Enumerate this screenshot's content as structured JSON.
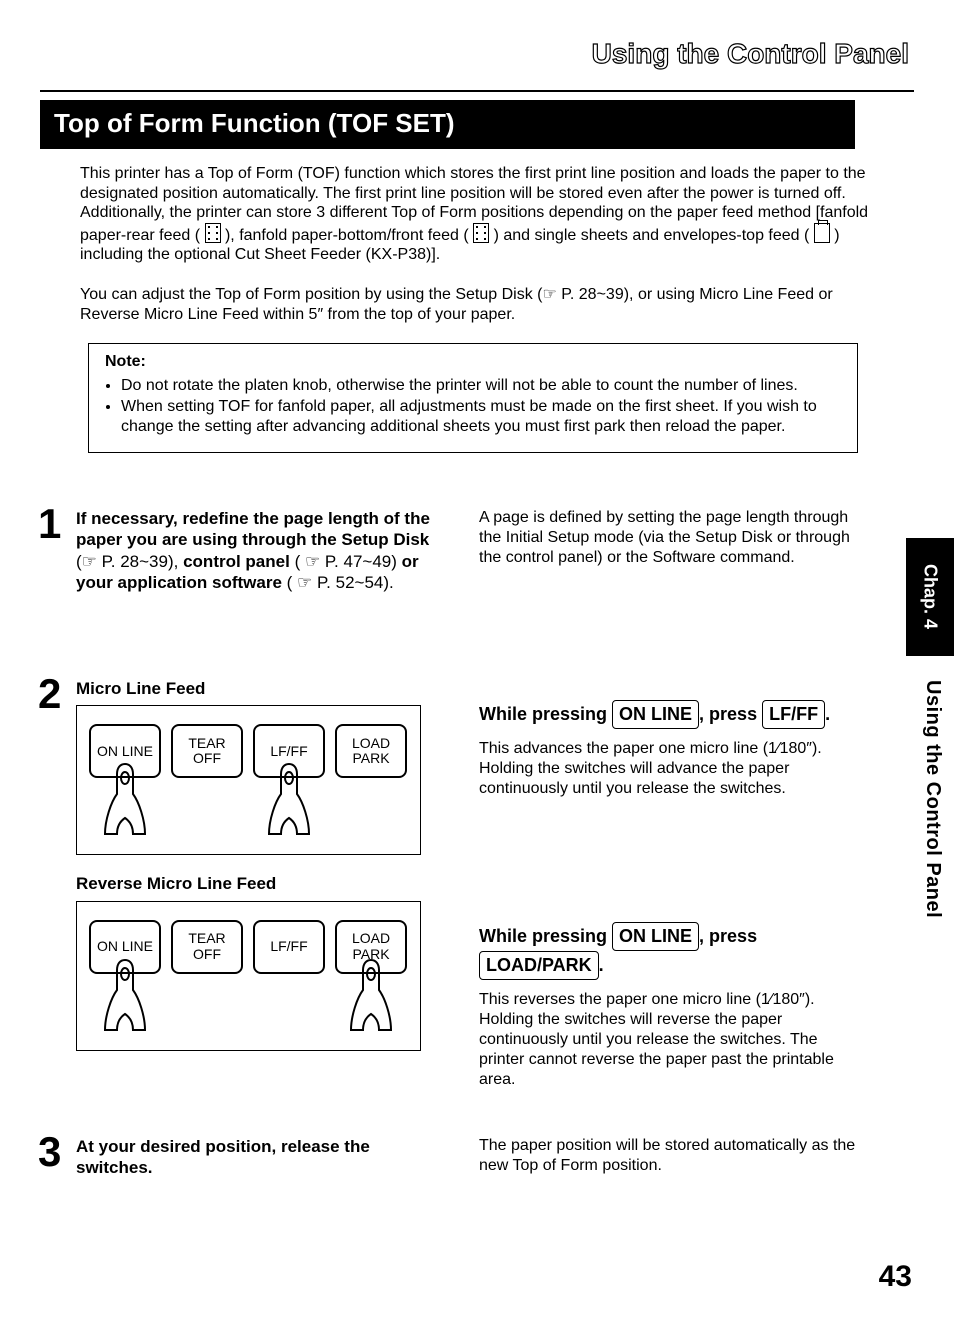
{
  "header": "Using the Control Panel",
  "title_bar": "Top of Form Function (TOF SET)",
  "intro_p1": "This printer has a Top of Form (TOF) function which stores the first print line position and loads the paper to the designated position automatically. The first print line position will be stored even after the power is turned off. Additionally, the printer can store 3 different Top of Form positions depending on the paper feed method [fanfold paper-rear feed (",
  "intro_p1_mid1": "), fanfold paper-bottom/front feed (",
  "intro_p1_mid2": ") and single sheets and envelopes-top feed (",
  "intro_p1_end": ") including the optional Cut Sheet Feeder (KX-P38)].",
  "intro_p2": "You can adjust the Top of Form position by using the Setup Disk (☞ P. 28~39), or using Micro Line Feed or Reverse Micro Line Feed within 5″ from the top of your paper.",
  "note_label": "Note:",
  "note_items": [
    "Do not rotate the platen knob, otherwise the printer will not be able to count the number of lines.",
    "When setting TOF for fanfold paper, all adjustments must be made on the first sheet. If you wish to change the setting after advancing additional sheets you must first park then reload the paper."
  ],
  "step1": {
    "num": "1",
    "left_a": "If necessary, redefine the page length of the paper you are using through the Setup Disk",
    "left_b": "(☞ P. 28~39),",
    "left_c": "control panel",
    "left_d": "( ☞ P. 47~49)",
    "left_e": "or your application software",
    "left_f": "( ☞ P. 52~54).",
    "right": "A page is defined by setting the page length through the Initial Setup mode (via the Setup Disk or through the control panel) or the Software command."
  },
  "step2": {
    "num": "2",
    "title_a": "Micro Line Feed",
    "title_b": "Reverse Micro Line Feed",
    "buttons": [
      "ON LINE",
      "TEAR OFF",
      "LF/FF",
      "LOAD PARK"
    ],
    "instr_a_pre": "While pressing ",
    "instr_a_key1": "ON LINE",
    "instr_a_mid": ", press ",
    "instr_a_key2": "LF/FF",
    "instr_a_post": ".",
    "body_a": "This advances the paper one micro line (1⁄180″). Holding the switches will advance the paper continuously until you release the switches.",
    "instr_b_pre": "While pressing ",
    "instr_b_key1": "ON LINE",
    "instr_b_mid": ", press ",
    "instr_b_key2": "LOAD/PARK",
    "instr_b_post": ".",
    "body_b": "This reverses the paper one micro line (1⁄180″). Holding the switches will reverse the paper continuously until you release the switches. The printer cannot reverse the paper past the printable area."
  },
  "step3": {
    "num": "3",
    "left": "At your desired position, release the switches.",
    "right": "The paper position will be stored automatically as the new Top of Form position."
  },
  "side_tab": "Chap. 4",
  "side_label": "Using the Control Panel",
  "page_number": "43"
}
